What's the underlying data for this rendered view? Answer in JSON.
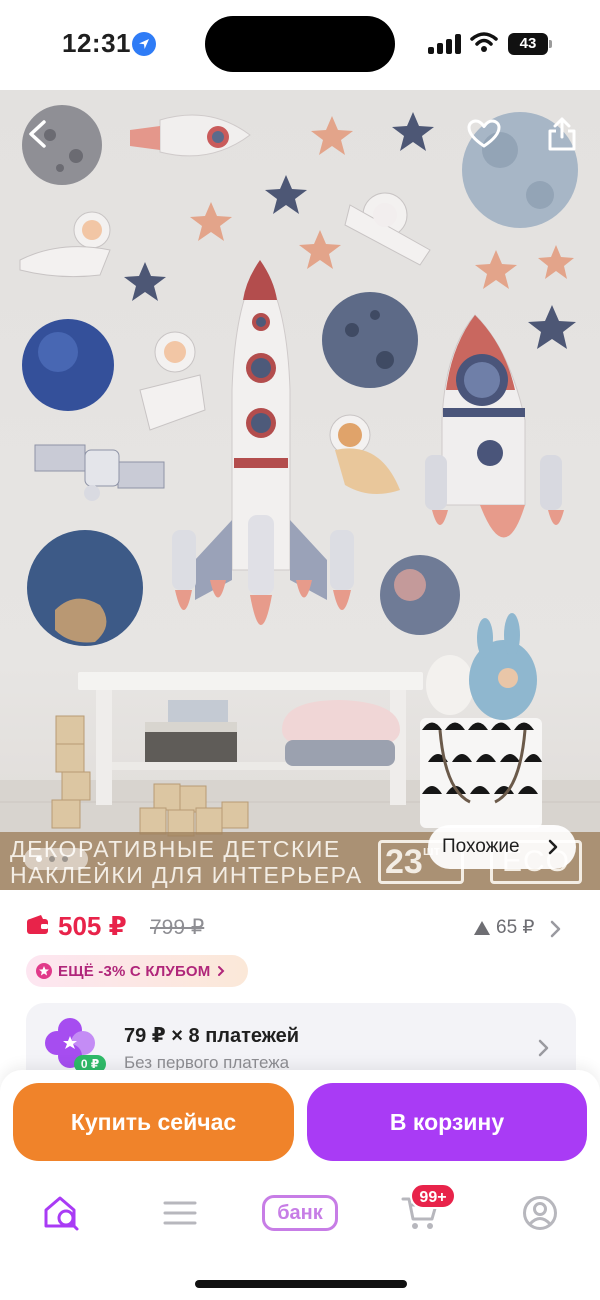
{
  "status_bar": {
    "time": "12:31",
    "battery": "43"
  },
  "hero": {
    "banner_line1": "ДЕКОРАТИВНЫЕ ДЕТСКИЕ",
    "banner_line2": "НАКЛЕЙКИ ДЛЯ ИНТЕРЬЕРА",
    "badge_count": "23",
    "badge_unit": "шт",
    "badge_eco": "ECO",
    "similar_label": "Похожие",
    "similar_chevron": "›"
  },
  "price": {
    "current": "505 ₽",
    "old": "799 ₽",
    "drop": "65 ₽"
  },
  "club": {
    "label": "ЕЩЁ -3% С КЛУБОМ"
  },
  "installment": {
    "title": "79 ₽ × 8 платежей",
    "subtitle": "Без первого платежа",
    "zero_badge": "0 ₽"
  },
  "actions": {
    "buy_now": "Купить сейчас",
    "add_to_cart": "В корзину"
  },
  "tab_bar": {
    "bank_label": "банк",
    "cart_badge": "99+"
  },
  "colors": {
    "accent_price": "#e8234a",
    "buy_now": "#f0832a",
    "add_to_cart": "#a93bf5",
    "tab_active": "#a93bf5",
    "bank": "#c77de6",
    "installment_green": "#2fba68"
  },
  "icons": [
    "location-arrow-icon",
    "signal-icon",
    "wifi-icon",
    "battery-icon",
    "back-chevron-icon",
    "heart-icon",
    "share-icon",
    "wallet-icon",
    "price-drop-triangle-icon",
    "club-star-icon",
    "installment-clover-icon",
    "home-search-icon",
    "catalog-menu-icon",
    "cart-icon",
    "profile-icon"
  ]
}
